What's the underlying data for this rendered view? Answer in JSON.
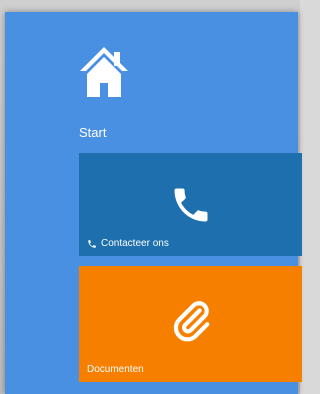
{
  "nav": {
    "home_icon": "home-icon"
  },
  "section": {
    "label": "Start"
  },
  "tiles": [
    {
      "label": "Contacteer ons",
      "icon": "phone-icon",
      "color": "#1d6fae"
    },
    {
      "label": "Documenten",
      "icon": "paperclip-icon",
      "color": "#f77f00"
    }
  ],
  "colors": {
    "panel_bg": "#4a90e2"
  }
}
